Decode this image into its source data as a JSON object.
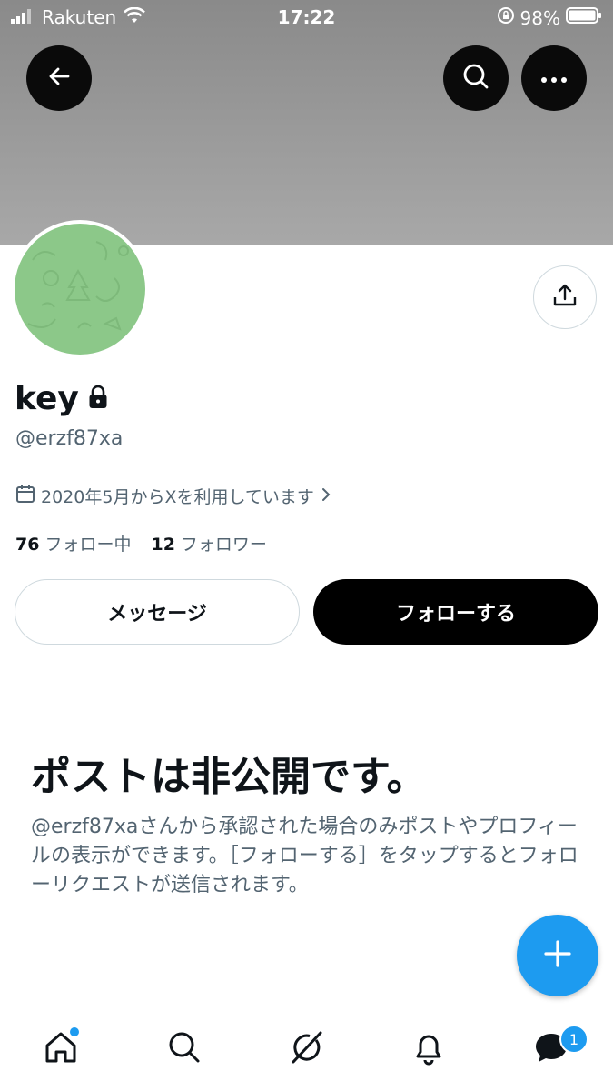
{
  "status_bar": {
    "carrier": "Rakuten",
    "time": "17:22",
    "battery": "98%"
  },
  "profile": {
    "name": "key",
    "handle": "@erzf87xa",
    "joined": "2020年5月からXを利用しています",
    "following_count": "76",
    "following_label": "フォロー中",
    "followers_count": "12",
    "followers_label": "フォロワー"
  },
  "actions": {
    "message_label": "メッセージ",
    "follow_label": "フォローする"
  },
  "private_notice": {
    "title": "ポストは非公開です。",
    "description": "@erzf87xaさんから承認された場合のみポストやプロフィールの表示ができます。［フォローする］をタップするとフォローリクエストが送信されます。"
  },
  "tabbar": {
    "items": [
      "home-icon",
      "search-icon",
      "grok-icon",
      "notifications-icon",
      "messages-icon"
    ],
    "messages_badge": "1"
  },
  "colors": {
    "accent": "#1d9bf0",
    "banner": "#9a9a9a",
    "avatar": "#8cc889"
  }
}
